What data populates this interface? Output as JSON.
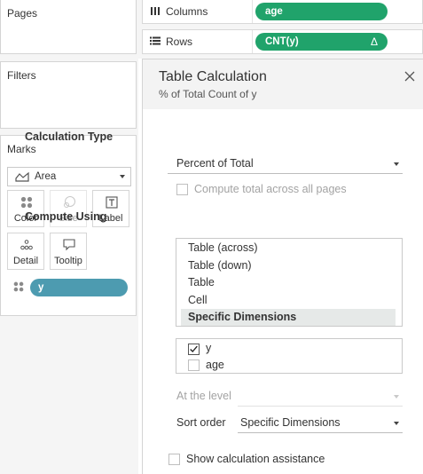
{
  "left_panel": {
    "pages_title": "Pages",
    "filters_title": "Filters",
    "marks": {
      "title": "Marks",
      "mark_type": "Area",
      "mark_type_icon": "area-chart-icon",
      "buttons": [
        {
          "label": "Color",
          "icon": "color-dots-icon",
          "enabled": true
        },
        {
          "label": "Size",
          "icon": "size-icon",
          "enabled": false
        },
        {
          "label": "Label",
          "icon": "text-label-icon",
          "enabled": true
        },
        {
          "label": "Detail",
          "icon": "detail-dots-icon",
          "enabled": true
        },
        {
          "label": "Tooltip",
          "icon": "tooltip-icon",
          "enabled": true
        }
      ],
      "pill": {
        "label": "y",
        "icon": "color-dots-icon",
        "color": "#4d9bb0"
      }
    }
  },
  "shelves": {
    "columns": {
      "label": "Columns",
      "icon": "columns-icon",
      "pill": "age",
      "pill_color": "#20a36b"
    },
    "rows": {
      "label": "Rows",
      "icon": "rows-icon",
      "pill": "CNT(y)",
      "pill_badge": "Δ",
      "pill_color": "#20a36b"
    }
  },
  "dialog": {
    "title": "Table Calculation",
    "subtitle": "% of Total Count of y",
    "calc_type_heading": "Calculation Type",
    "calc_type_value": "Percent of Total",
    "compute_all_pages_label": "Compute total across all pages",
    "compute_all_pages_checked": false,
    "compute_using_heading": "Compute Using",
    "compute_using_options": [
      "Table (across)",
      "Table (down)",
      "Table",
      "Cell",
      "Specific Dimensions"
    ],
    "compute_using_selected": "Specific Dimensions",
    "dimensions": [
      {
        "label": "y",
        "checked": true
      },
      {
        "label": "age",
        "checked": false
      }
    ],
    "at_level_label": "At the level",
    "at_level_value": "",
    "sort_order_label": "Sort order",
    "sort_order_value": "Specific Dimensions",
    "show_assistance_label": "Show calculation assistance",
    "show_assistance_checked": false
  }
}
